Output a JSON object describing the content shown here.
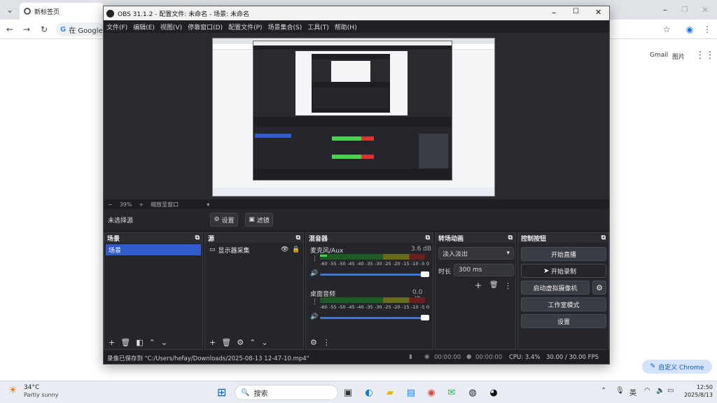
{
  "browser": {
    "tab_title": "新标签页",
    "search_hint": "在 Google",
    "gmail": "Gmail",
    "images": "图片",
    "customize_chrome": "自定义 Chrome"
  },
  "obs": {
    "title": "OBS 31.1.2 - 配置文件: 未命名 - 场景: 未命名",
    "menu": [
      "文件(F)",
      "编辑(E)",
      "视图(V)",
      "停靠窗口(D)",
      "配置文件(P)",
      "场景集合(S)",
      "工具(T)",
      "帮助(H)"
    ],
    "zoom_pct": "39%",
    "zoom_fit": "缩放至窗口",
    "no_source": "未选择源",
    "settings_btn": "设置",
    "filters_btn": "滤镜",
    "scenes_panel": {
      "title": "场景",
      "items": [
        "场景"
      ]
    },
    "sources_panel": {
      "title": "源",
      "items": [
        "显示器采集"
      ]
    },
    "mixer_panel": {
      "title": "混音器",
      "channels": [
        {
          "name": "麦克风/Aux",
          "db": "3.6 dB"
        },
        {
          "name": "桌面音频",
          "db": "0.0 dB"
        }
      ],
      "scale": [
        "-60",
        "-55",
        "-50",
        "-45",
        "-40",
        "-35",
        "-30",
        "-25",
        "-20",
        "-15",
        "-10",
        "-5",
        "0"
      ]
    },
    "transitions_panel": {
      "title": "转场动画",
      "transition": "淡入淡出",
      "duration_label": "时长",
      "duration": "300 ms"
    },
    "controls_panel": {
      "title": "控制按钮",
      "start_stream": "开始直播",
      "start_record": "开始录制",
      "virtual_cam": "启动虚拟摄像机",
      "studio_mode": "工作室模式",
      "settings": "设置"
    },
    "status": {
      "recording_saved": "录像已保存到 \"C:/Users/hefay/Downloads/2025-08-13 12-47-10.mp4\"",
      "stream_time": "00:00:00",
      "rec_time": "00:00:00",
      "cpu": "CPU: 3.4%",
      "fps": "30.00 / 30.00 FPS"
    }
  },
  "taskbar": {
    "weather_temp": "34°C",
    "weather_desc": "Partly sunny",
    "search": "搜索",
    "ime": "英",
    "time": "12:50",
    "date": "2025/8/13"
  },
  "colors": {
    "accent": "#2f5cc9",
    "obs_bg": "#1e1f23",
    "panel": "#25262b"
  }
}
